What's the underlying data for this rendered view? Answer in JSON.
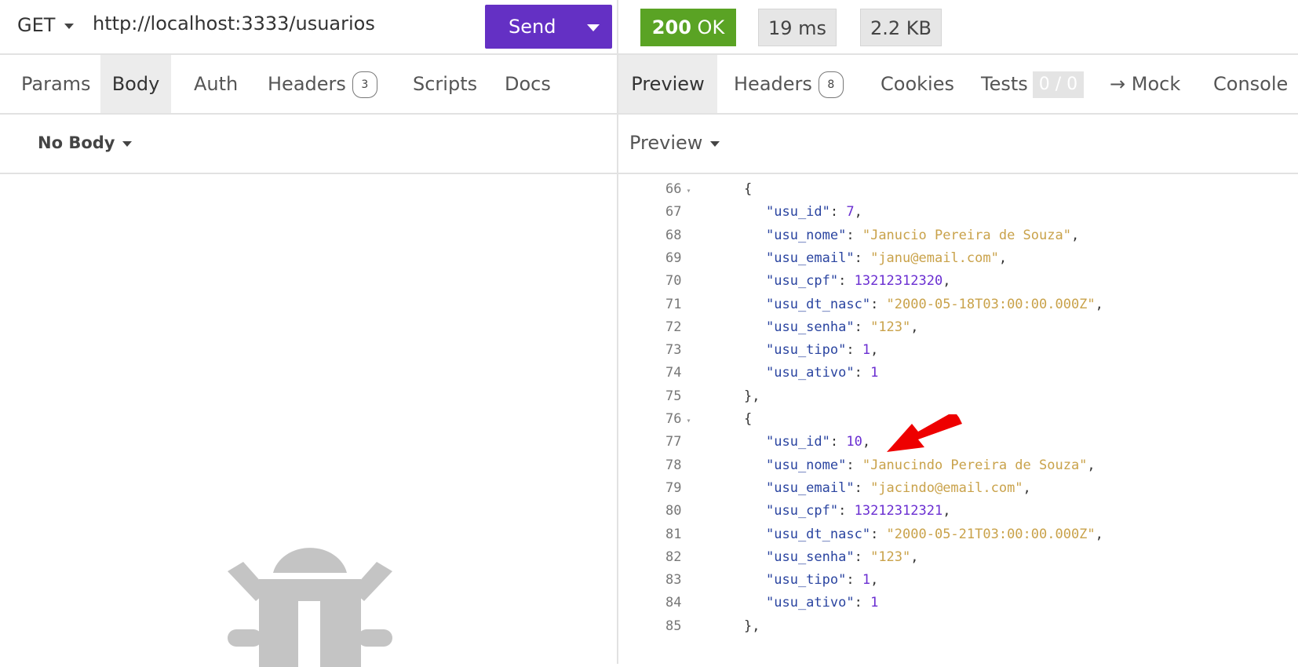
{
  "request": {
    "method": "GET",
    "url": "http://localhost:3333/usuarios",
    "send_label": "Send",
    "tabs": [
      {
        "label": "Params"
      },
      {
        "label": "Body"
      },
      {
        "label": "Auth"
      },
      {
        "label": "Headers",
        "badge": "3"
      },
      {
        "label": "Scripts"
      },
      {
        "label": "Docs"
      }
    ],
    "body_mode": "No Body"
  },
  "response": {
    "status_code": "200",
    "status_text": "OK",
    "time": "19 ms",
    "size": "2.2 KB",
    "tabs": [
      {
        "label": "Preview"
      },
      {
        "label": "Headers",
        "badge": "8"
      },
      {
        "label": "Cookies"
      },
      {
        "label": "Tests",
        "badge": "0 / 0"
      },
      {
        "label": "→ Mock"
      },
      {
        "label": "Console"
      }
    ],
    "preview_mode": "Preview",
    "lines": [
      {
        "n": "66",
        "fold": true,
        "parts": [
          [
            "pun",
            "{"
          ]
        ],
        "indent": 0
      },
      {
        "n": "67",
        "parts": [
          [
            "key",
            "\"usu_id\""
          ],
          [
            "pun",
            ": "
          ],
          [
            "num",
            "7"
          ],
          [
            "pun",
            ","
          ]
        ],
        "indent": 1
      },
      {
        "n": "68",
        "parts": [
          [
            "key",
            "\"usu_nome\""
          ],
          [
            "pun",
            ": "
          ],
          [
            "str",
            "\"Janucio Pereira de Souza\""
          ],
          [
            "pun",
            ","
          ]
        ],
        "indent": 1
      },
      {
        "n": "69",
        "parts": [
          [
            "key",
            "\"usu_email\""
          ],
          [
            "pun",
            ": "
          ],
          [
            "str",
            "\"janu@email.com\""
          ],
          [
            "pun",
            ","
          ]
        ],
        "indent": 1
      },
      {
        "n": "70",
        "parts": [
          [
            "key",
            "\"usu_cpf\""
          ],
          [
            "pun",
            ": "
          ],
          [
            "num",
            "13212312320"
          ],
          [
            "pun",
            ","
          ]
        ],
        "indent": 1
      },
      {
        "n": "71",
        "parts": [
          [
            "key",
            "\"usu_dt_nasc\""
          ],
          [
            "pun",
            ": "
          ],
          [
            "str",
            "\"2000-05-18T03:00:00.000Z\""
          ],
          [
            "pun",
            ","
          ]
        ],
        "indent": 1
      },
      {
        "n": "72",
        "parts": [
          [
            "key",
            "\"usu_senha\""
          ],
          [
            "pun",
            ": "
          ],
          [
            "str",
            "\"123\""
          ],
          [
            "pun",
            ","
          ]
        ],
        "indent": 1
      },
      {
        "n": "73",
        "parts": [
          [
            "key",
            "\"usu_tipo\""
          ],
          [
            "pun",
            ": "
          ],
          [
            "num",
            "1"
          ],
          [
            "pun",
            ","
          ]
        ],
        "indent": 1
      },
      {
        "n": "74",
        "parts": [
          [
            "key",
            "\"usu_ativo\""
          ],
          [
            "pun",
            ": "
          ],
          [
            "num",
            "1"
          ]
        ],
        "indent": 1
      },
      {
        "n": "75",
        "parts": [
          [
            "pun",
            "},"
          ]
        ],
        "indent": 0
      },
      {
        "n": "76",
        "fold": true,
        "parts": [
          [
            "pun",
            "{"
          ]
        ],
        "indent": 0
      },
      {
        "n": "77",
        "parts": [
          [
            "key",
            "\"usu_id\""
          ],
          [
            "pun",
            ": "
          ],
          [
            "num",
            "10"
          ],
          [
            "pun",
            ","
          ]
        ],
        "indent": 1
      },
      {
        "n": "78",
        "parts": [
          [
            "key",
            "\"usu_nome\""
          ],
          [
            "pun",
            ": "
          ],
          [
            "str",
            "\"Janucindo Pereira de Souza\""
          ],
          [
            "pun",
            ","
          ]
        ],
        "indent": 1
      },
      {
        "n": "79",
        "parts": [
          [
            "key",
            "\"usu_email\""
          ],
          [
            "pun",
            ": "
          ],
          [
            "str",
            "\"jacindo@email.com\""
          ],
          [
            "pun",
            ","
          ]
        ],
        "indent": 1
      },
      {
        "n": "80",
        "parts": [
          [
            "key",
            "\"usu_cpf\""
          ],
          [
            "pun",
            ": "
          ],
          [
            "num",
            "13212312321"
          ],
          [
            "pun",
            ","
          ]
        ],
        "indent": 1
      },
      {
        "n": "81",
        "parts": [
          [
            "key",
            "\"usu_dt_nasc\""
          ],
          [
            "pun",
            ": "
          ],
          [
            "str",
            "\"2000-05-21T03:00:00.000Z\""
          ],
          [
            "pun",
            ","
          ]
        ],
        "indent": 1
      },
      {
        "n": "82",
        "parts": [
          [
            "key",
            "\"usu_senha\""
          ],
          [
            "pun",
            ": "
          ],
          [
            "str",
            "\"123\""
          ],
          [
            "pun",
            ","
          ]
        ],
        "indent": 1
      },
      {
        "n": "83",
        "parts": [
          [
            "key",
            "\"usu_tipo\""
          ],
          [
            "pun",
            ": "
          ],
          [
            "num",
            "1"
          ],
          [
            "pun",
            ","
          ]
        ],
        "indent": 1
      },
      {
        "n": "84",
        "parts": [
          [
            "key",
            "\"usu_ativo\""
          ],
          [
            "pun",
            ": "
          ],
          [
            "num",
            "1"
          ]
        ],
        "indent": 1
      },
      {
        "n": "85",
        "parts": [
          [
            "pun",
            "},"
          ]
        ],
        "indent": 0
      }
    ]
  },
  "icons": {
    "empty_state": "bug-icon",
    "annotation": "red-arrow-annotation"
  },
  "colors": {
    "send_button": "#6430c4",
    "status_ok": "#5aa324",
    "json_key": "#2a44a0",
    "json_string": "#c9a24a",
    "json_number": "#6a2ed1",
    "annotation_arrow": "#ee0000"
  }
}
